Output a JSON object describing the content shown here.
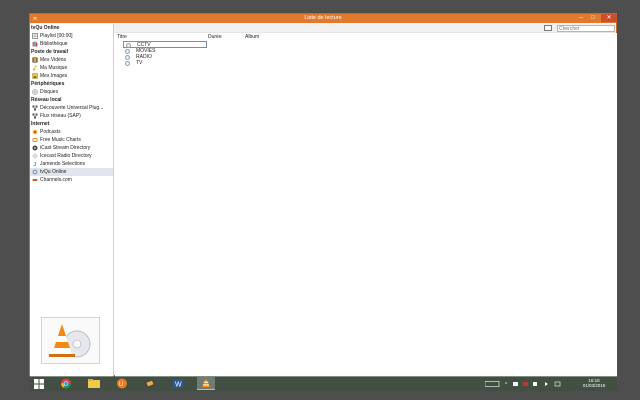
{
  "window": {
    "title": "Liste de lecture",
    "buttons": {
      "minimize": "–",
      "maximize": "□",
      "close": "✕"
    }
  },
  "toolbar": {
    "search_placeholder": "Chercher"
  },
  "sidebar": {
    "sections": [
      {
        "title": "tvQu Online",
        "items": [
          {
            "label": "Playlist [00:00]",
            "icon": "playlist-icon"
          },
          {
            "label": "Bibliothèque",
            "icon": "library-icon"
          }
        ]
      },
      {
        "title": "Poste de travail",
        "items": [
          {
            "label": "Mes Vidéos",
            "icon": "videos-icon"
          },
          {
            "label": "Ma Musique",
            "icon": "music-icon"
          },
          {
            "label": "Mes Images",
            "icon": "images-icon"
          }
        ]
      },
      {
        "title": "Périphériques",
        "items": [
          {
            "label": "Disques",
            "icon": "disc-icon"
          }
        ]
      },
      {
        "title": "Réseau local",
        "items": [
          {
            "label": "Découverte Universal Plug...",
            "icon": "network-icon"
          },
          {
            "label": "Flux réseau (SAP)",
            "icon": "network-icon"
          }
        ]
      },
      {
        "title": "Internet",
        "items": [
          {
            "label": "Podcasts",
            "icon": "podcast-icon"
          },
          {
            "label": "Free Music Charts",
            "icon": "music-charts-icon"
          },
          {
            "label": "iCast Stream Directory",
            "icon": "stream-icon"
          },
          {
            "label": "Icecast Radio Directory",
            "icon": "radio-icon"
          },
          {
            "label": "Jamendo Selections",
            "icon": "jamendo-icon"
          },
          {
            "label": "tvQu Online",
            "icon": "tv-online-icon",
            "selected": true
          },
          {
            "label": "Channels.com",
            "icon": "channels-icon"
          }
        ]
      }
    ]
  },
  "main": {
    "columns": [
      "Titre",
      "Durée",
      "Album"
    ],
    "rows": [
      {
        "title": "CCTV",
        "active": true
      },
      {
        "title": "MOVIES"
      },
      {
        "title": "RADIO"
      },
      {
        "title": "TV"
      }
    ]
  },
  "taskbar": {
    "time": "16:18",
    "date": "01/03/2016",
    "apps": [
      "start-icon",
      "chrome-icon",
      "file-explorer-icon",
      "ucbrowser-icon",
      "media-icon",
      "word-icon",
      "vlc-icon"
    ]
  },
  "colors": {
    "titlebar": "#e07a2e",
    "close": "#c9502a",
    "selected": "#e1e6ee"
  }
}
